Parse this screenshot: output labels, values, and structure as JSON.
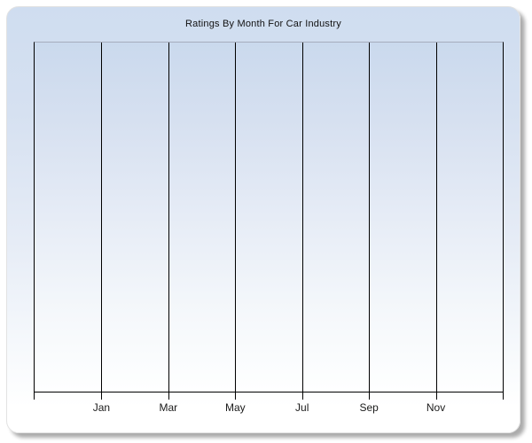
{
  "chart_data": {
    "type": "line",
    "title": "Ratings By Month For Car Industry",
    "categories": [
      "Jan",
      "Mar",
      "May",
      "Jul",
      "Sep",
      "Nov"
    ],
    "series": [],
    "xlabel": "",
    "ylabel": "",
    "x_axis": {
      "tick_labels": [
        "Jan",
        "Mar",
        "May",
        "Jul",
        "Sep",
        "Nov"
      ],
      "label_interval_months": 2,
      "gridlines": "vertical",
      "columns": 7
    },
    "y_axis": {
      "tick_labels": [],
      "gridlines": "none"
    },
    "legend": {
      "visible": false
    },
    "plot_empty": true
  },
  "colors": {
    "panel_top": "#cfddf0",
    "panel_bottom": "#ffffff",
    "plot_top": "#cad9ed",
    "plot_bottom": "#feffff",
    "gridline": "#000000",
    "plot_top_border": "#a6adbd",
    "title_text": "#111111",
    "axis_label_text": "#1a1a1a",
    "shadow": "#aaaaaa"
  }
}
